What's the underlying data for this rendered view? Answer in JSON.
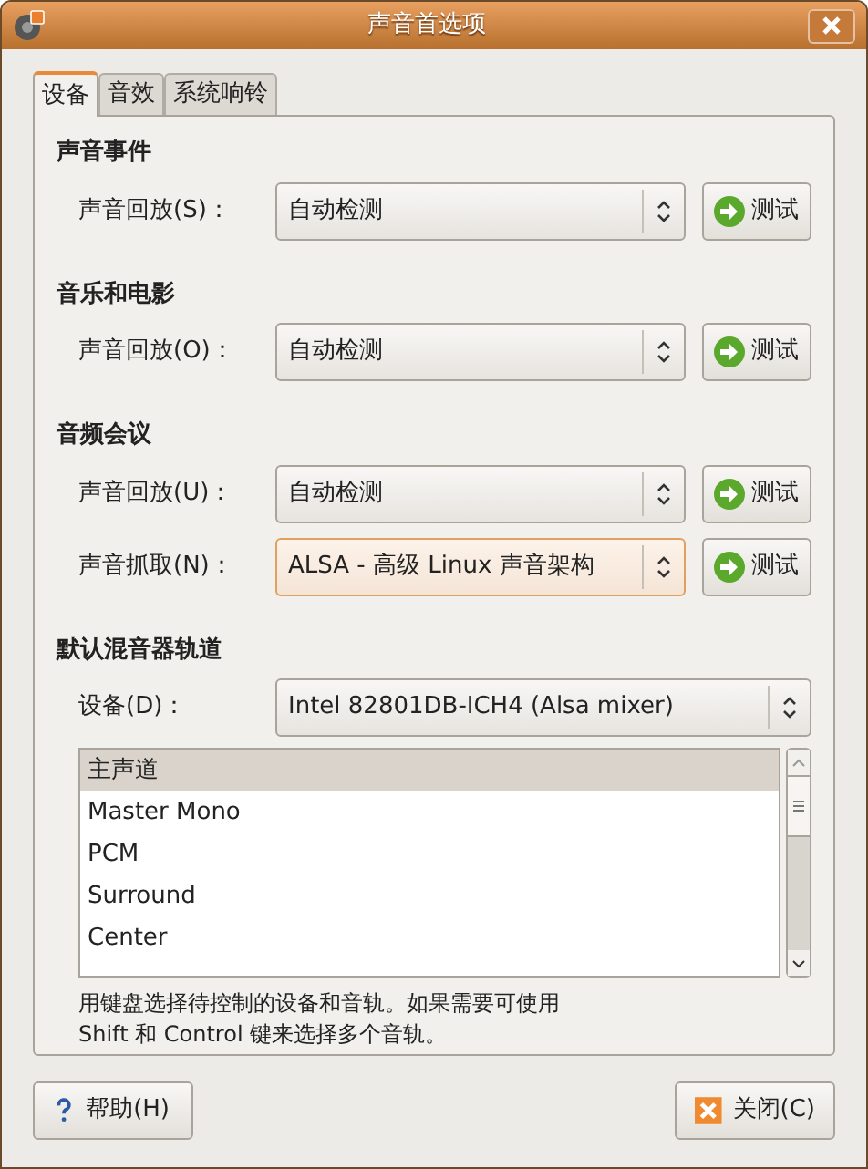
{
  "window": {
    "title": "声音首选项"
  },
  "tabs": [
    {
      "label": "设备",
      "selected": true
    },
    {
      "label": "音效",
      "selected": false
    },
    {
      "label": "系统响铃",
      "selected": false
    }
  ],
  "sections": [
    {
      "title": "声音事件",
      "rows": [
        {
          "label": "声音回放(S)：",
          "value": "自动检测",
          "focused": false,
          "button": "测试"
        }
      ]
    },
    {
      "title": "音乐和电影",
      "rows": [
        {
          "label": "声音回放(O)：",
          "value": "自动检测",
          "focused": false,
          "button": "测试"
        }
      ]
    },
    {
      "title": "音频会议",
      "rows": [
        {
          "label": "声音回放(U)：",
          "value": "自动检测",
          "focused": false,
          "button": "测试"
        },
        {
          "label": "声音抓取(N)：",
          "value": "ALSA - 高级 Linux 声音架构",
          "focused": true,
          "button": "测试"
        }
      ]
    }
  ],
  "mixer": {
    "title": "默认混音器轨道",
    "device_label": "设备(D)：",
    "device_value": "Intel 82801DB-ICH4 (Alsa mixer)",
    "tracks": [
      {
        "name": "主声道",
        "selected": true
      },
      {
        "name": "Master Mono",
        "selected": false
      },
      {
        "name": "PCM",
        "selected": false
      },
      {
        "name": "Surround",
        "selected": false
      },
      {
        "name": "Center",
        "selected": false
      }
    ],
    "hint": [
      "用键盘选择待控制的设备和音轨。如果需要可使用",
      "Shift 和 Control 键来选择多个音轨。"
    ]
  },
  "buttons": {
    "help": "帮助(H)",
    "close": "关闭(C)"
  }
}
